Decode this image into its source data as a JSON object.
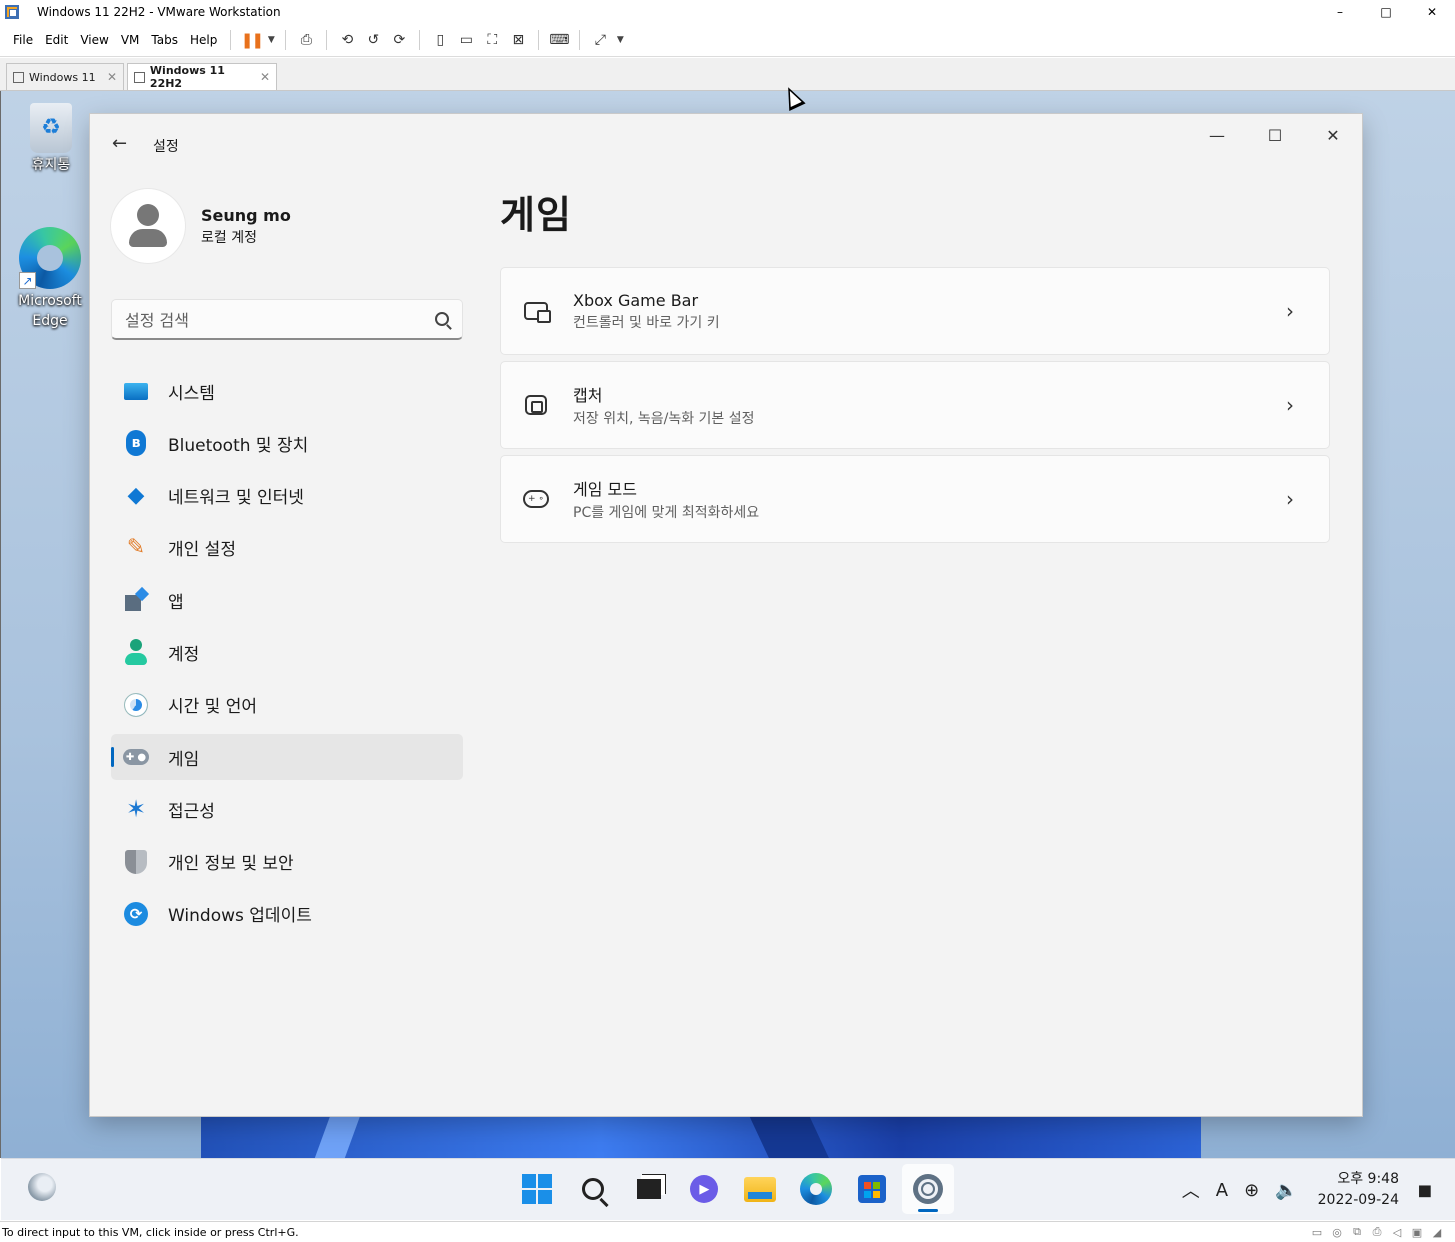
{
  "vmware": {
    "window_title": "Windows 11 22H2 - VMware Workstation",
    "window_controls": {
      "minimize": "–",
      "maximize": "□",
      "close": "✕"
    },
    "menu": [
      "File",
      "Edit",
      "View",
      "VM",
      "Tabs",
      "Help"
    ],
    "tabs": [
      {
        "label": "Windows 11",
        "active": false
      },
      {
        "label": "Windows 11 22H2",
        "active": true
      }
    ],
    "status_text": "To direct input to this VM, click inside or press Ctrl+G."
  },
  "desktop": {
    "icons": [
      {
        "label": "휴지통"
      },
      {
        "label": "Microsoft Edge"
      }
    ]
  },
  "settings": {
    "app_title": "설정",
    "profile": {
      "name": "Seung mo",
      "account_type": "로컬 계정"
    },
    "search_placeholder": "설정 검색",
    "nav": [
      {
        "label": "시스템",
        "icon": "system-icon"
      },
      {
        "label": "Bluetooth 및 장치",
        "icon": "bluetooth-icon"
      },
      {
        "label": "네트워크 및 인터넷",
        "icon": "wifi-icon"
      },
      {
        "label": "개인 설정",
        "icon": "brush-icon"
      },
      {
        "label": "앱",
        "icon": "apps-icon"
      },
      {
        "label": "계정",
        "icon": "account-icon"
      },
      {
        "label": "시간 및 언어",
        "icon": "clock-globe-icon"
      },
      {
        "label": "게임",
        "icon": "gamepad-icon",
        "selected": true
      },
      {
        "label": "접근성",
        "icon": "accessibility-icon"
      },
      {
        "label": "개인 정보 및 보안",
        "icon": "shield-icon"
      },
      {
        "label": "Windows 업데이트",
        "icon": "update-icon"
      }
    ],
    "page_title": "게임",
    "cards": [
      {
        "title": "Xbox Game Bar",
        "subtitle": "컨트롤러 및 바로 가기 키",
        "icon": "game-bar-icon"
      },
      {
        "title": "캡처",
        "subtitle": "저장 위치, 녹음/녹화 기본 설정",
        "icon": "capture-icon"
      },
      {
        "title": "게임 모드",
        "subtitle": "PC를 게임에 맞게 최적화하세요",
        "icon": "game-mode-icon"
      }
    ]
  },
  "taskbar": {
    "apps": [
      "start",
      "search",
      "task-view",
      "chat",
      "file-explorer",
      "edge",
      "store",
      "settings"
    ],
    "active_app": "settings",
    "ime": "A",
    "time": "오후 9:48",
    "date": "2022-09-24"
  },
  "colors": {
    "accent": "#0067c0",
    "settings_bg": "#f3f3f3",
    "card_bg": "#fbfbfb"
  }
}
